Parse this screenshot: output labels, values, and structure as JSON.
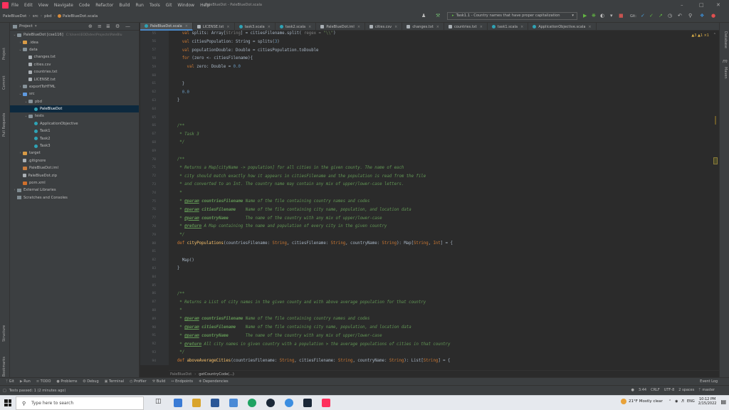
{
  "menubar": {
    "items": [
      "File",
      "Edit",
      "View",
      "Navigate",
      "Code",
      "Refactor",
      "Build",
      "Run",
      "Tools",
      "Git",
      "Window",
      "Help"
    ],
    "window_title": "PaleBlueDot - PaleBlueDot.scala"
  },
  "navbar": {
    "breadcrumbs": [
      "PaleBlueDot",
      "src",
      "pbd",
      "PaleBlueDot.scala"
    ],
    "run_config": "Task1.1 - Country names that have proper capitalization",
    "git_label": "Git:"
  },
  "project": {
    "header": "Project",
    "tree": [
      {
        "label": "PaleBlueDot [cse116]",
        "extra": "C:\\Users\\EOD\\dev\\Projects\\PaleBlu",
        "depth": 0,
        "icon": "folder",
        "arrow": "v"
      },
      {
        "label": ".idea",
        "depth": 1,
        "icon": "folder-orange",
        "arrow": ">"
      },
      {
        "label": "data",
        "depth": 1,
        "icon": "folder",
        "arrow": "v"
      },
      {
        "label": "changes.txt",
        "depth": 2,
        "icon": "file"
      },
      {
        "label": "cities.csv",
        "depth": 2,
        "icon": "file"
      },
      {
        "label": "countries.txt",
        "depth": 2,
        "icon": "file"
      },
      {
        "label": "LICENSE.txt",
        "depth": 2,
        "icon": "file"
      },
      {
        "label": "exportToHTML",
        "depth": 1,
        "icon": "folder",
        "arrow": ">"
      },
      {
        "label": "src",
        "depth": 1,
        "icon": "folder-blue",
        "arrow": "v"
      },
      {
        "label": "pbd",
        "depth": 2,
        "icon": "folder",
        "arrow": "v"
      },
      {
        "label": "PaleBlueDot",
        "depth": 3,
        "icon": "scala",
        "selected": true
      },
      {
        "label": "tests",
        "depth": 2,
        "icon": "folder",
        "arrow": "v"
      },
      {
        "label": "ApplicationObjective",
        "depth": 3,
        "icon": "scala"
      },
      {
        "label": "Task1",
        "depth": 3,
        "icon": "scala"
      },
      {
        "label": "Task2",
        "depth": 3,
        "icon": "scala"
      },
      {
        "label": "Task3",
        "depth": 3,
        "icon": "scala"
      },
      {
        "label": "target",
        "depth": 1,
        "icon": "folder-orange",
        "arrow": ">"
      },
      {
        "label": ".gitignore",
        "depth": 1,
        "icon": "file"
      },
      {
        "label": "PaleBlueDot.iml",
        "depth": 1,
        "icon": "iml"
      },
      {
        "label": "PaleBlueDot.zip",
        "depth": 1,
        "icon": "file"
      },
      {
        "label": "pom.xml",
        "depth": 1,
        "icon": "xml"
      },
      {
        "label": "External Libraries",
        "depth": 0,
        "icon": "lib",
        "arrow": ">"
      },
      {
        "label": "Scratches and Consoles",
        "depth": 0,
        "icon": "lib"
      }
    ]
  },
  "tabs": [
    {
      "label": "PaleBlueDot.scala",
      "active": true
    },
    {
      "label": "LICENSE.txt"
    },
    {
      "label": "task3.scala"
    },
    {
      "label": "task2.scala"
    },
    {
      "label": "PaleBlueDot.iml"
    },
    {
      "label": "cities.csv"
    },
    {
      "label": "changes.txt"
    },
    {
      "label": "countries.txt"
    },
    {
      "label": "task1.scala"
    },
    {
      "label": "ApplicationObjective.scala"
    }
  ],
  "editor": {
    "inspection_counts": "▲3 ▲1 ×1",
    "lines": [
      {
        "n": "55",
        "html": "    <span class='kw'>val</span> splits: <span class='typ'>Array</span>[<span class='grey'>String</span>] = citiesFilename.split( <span class='grey'>regex =</span> <span class='str'>\"\\\\\"</span>)"
      },
      {
        "n": "56",
        "html": "    <span class='kw'>val</span> citiesPopulation: <span class='typ'>String</span> = splits(<span class='num'>3</span>)"
      },
      {
        "n": "57",
        "html": "    <span class='kw'>val</span> populationDouble: <span class='typ'>Double</span> = citiesPopulation.toDouble"
      },
      {
        "n": "58",
        "html": "    <span class='kw'>for</span> (zero <- citiesFilename){"
      },
      {
        "n": "59",
        "html": "      <span class='kw'>val</span> zero: <span class='typ'>Double</span> = <span class='num'>0.0</span>"
      },
      {
        "n": "60",
        "html": ""
      },
      {
        "n": "61",
        "html": "    }"
      },
      {
        "n": "62",
        "html": "    <span class='num'>0.0</span>"
      },
      {
        "n": "63",
        "html": "  }"
      },
      {
        "n": "64",
        "html": ""
      },
      {
        "n": "65",
        "html": ""
      },
      {
        "n": "66",
        "html": "  <span class='doc'>/**</span>"
      },
      {
        "n": "67",
        "html": "  <span class='doc'> * Task 3</span>"
      },
      {
        "n": "68",
        "html": "  <span class='doc'> */</span>"
      },
      {
        "n": "69",
        "html": ""
      },
      {
        "n": "70",
        "html": "  <span class='doc'>/**</span>"
      },
      {
        "n": "71",
        "html": "  <span class='doc'> * Returns a Map[cityName -> population] for all cities in the given county. The name of each</span>"
      },
      {
        "n": "72",
        "html": "  <span class='doc'> * city should match exactly how it appears in citiesFilename and the population is read from the file</span>"
      },
      {
        "n": "73",
        "html": "  <span class='doc'> * and converted to an Int. The country name may contain any mix of upper/lower-case letters.</span>"
      },
      {
        "n": "74",
        "html": "  <span class='doc'> *</span>"
      },
      {
        "n": "75",
        "html": "  <span class='doc'> * </span><span class='doctag'>@param</span><span class='doc'> <b>countriesFilename</b> Name of the file containing country names and codes</span>"
      },
      {
        "n": "76",
        "html": "  <span class='doc'> * </span><span class='doctag'>@param</span><span class='doc'> <b>citiesFilename</b>    Name of the file containing city name, population, and location data</span>"
      },
      {
        "n": "77",
        "html": "  <span class='doc'> * </span><span class='doctag'>@param</span><span class='doc'> <b>countryName</b>       The name of the country with any mix of upper/lower-case</span>"
      },
      {
        "n": "78",
        "html": "  <span class='doc'> * </span><span class='doctag'>@return</span><span class='doc'> A Map containing the name and population of every city in the given country</span>"
      },
      {
        "n": "79",
        "html": "  <span class='doc'> */</span>"
      },
      {
        "n": "80",
        "html": "  <span class='kw'>def</span> <span class='fn'>cityPopulations</span>(countriesFilename: <span class='kw'>String</span>, citiesFilename: <span class='kw'>String</span>, countryName: <span class='kw'>String</span>): <span class='typ'>Map</span>[<span class='kw'>String</span>, <span class='kw'>Int</span>] = {"
      },
      {
        "n": "81",
        "html": ""
      },
      {
        "n": "82",
        "html": "    <span class='typ'>Map</span>()"
      },
      {
        "n": "83",
        "html": "  }"
      },
      {
        "n": "84",
        "html": ""
      },
      {
        "n": "85",
        "html": ""
      },
      {
        "n": "86",
        "html": "  <span class='doc'>/**</span>"
      },
      {
        "n": "87",
        "html": "  <span class='doc'> * Returns a List of city names in the given county and with above average population for that country</span>"
      },
      {
        "n": "88",
        "html": "  <span class='doc'> *</span>"
      },
      {
        "n": "89",
        "html": "  <span class='doc'> * </span><span class='doctag'>@param</span><span class='doc'> <b>countriesFilename</b> Name of the file containing country names and codes</span>"
      },
      {
        "n": "90",
        "html": "  <span class='doc'> * </span><span class='doctag'>@param</span><span class='doc'> <b>citiesFilename</b>    Name of the file containing city name, population, and location data</span>"
      },
      {
        "n": "91",
        "html": "  <span class='doc'> * </span><span class='doctag'>@param</span><span class='doc'> <b>countryName</b>       The name of the country with any mix of upper/lower-case</span>"
      },
      {
        "n": "92",
        "html": "  <span class='doc'> * </span><span class='doctag'>@return</span><span class='doc'> All city names in given country with a population > the average populations of cities in that country</span>"
      },
      {
        "n": "93",
        "html": "  <span class='doc'> */</span>"
      },
      {
        "n": "94",
        "html": "  <span class='kw'>def</span> <span class='fn'>aboveAverageCities</span>(countriesFilename: <span class='kw'>String</span>, citiesFilename: <span class='kw'>String</span>, countryName: <span class='kw'>String</span>): <span class='typ'>List</span>[<span class='kw'>String</span>] = {"
      }
    ],
    "breadcrumb": [
      "PaleBlueDot",
      "getCountryCode(...)"
    ]
  },
  "left_strip": [
    "Project",
    "Commit",
    "Pull Requests",
    "Structure",
    "Bookmarks"
  ],
  "right_strip": [
    "Database",
    "m",
    "Maven"
  ],
  "tool_tabs": [
    "Git",
    "Run",
    "TODO",
    "Problems",
    "Debug",
    "Terminal",
    "Profiler",
    "Build",
    "Endpoints",
    "Dependencies"
  ],
  "event_log": "Event Log",
  "status": {
    "message": "Tests passed: 1 (2 minutes ago)",
    "position": "3:44",
    "line_sep": "CRLF",
    "encoding": "UTF-8",
    "indent": "2 spaces",
    "branch": "master"
  },
  "taskbar": {
    "search_placeholder": "Type here to search",
    "weather": "21°F  Mostly clear",
    "lang": "ENG",
    "time": "10:12 PM",
    "date": "2/15/2022"
  }
}
